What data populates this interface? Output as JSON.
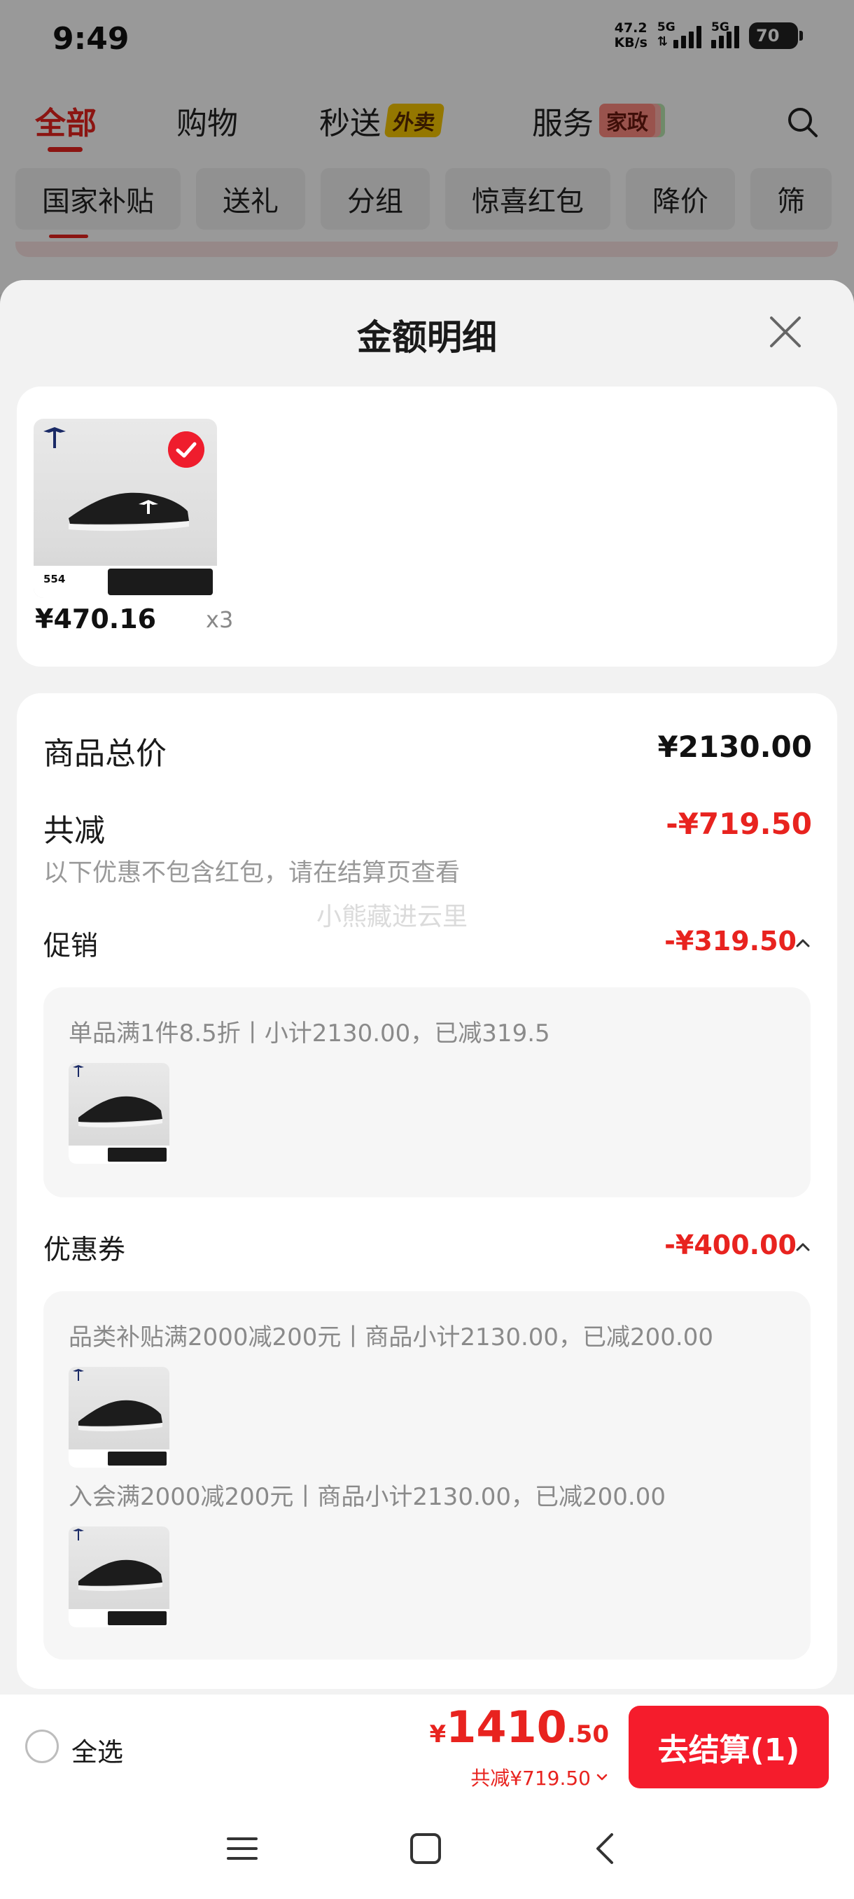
{
  "status_bar": {
    "time": "9:49",
    "net_speed_value": "47.2",
    "net_speed_unit": "KB/s",
    "sim1_label": "5G",
    "sim2_label": "5G",
    "battery": "70"
  },
  "top_tabs": [
    {
      "label": "全部"
    },
    {
      "label": "购物"
    },
    {
      "label": "秒送",
      "badge": "外卖"
    },
    {
      "label": "服务",
      "badge": "家政"
    }
  ],
  "chips": [
    "国家补贴",
    "送礼",
    "分组",
    "惊喜红包",
    "降价",
    "筛"
  ],
  "sheet": {
    "title": "金额明细",
    "product": {
      "price": "¥470.16",
      "qty": "x3",
      "thumb_price": "554"
    },
    "total_price_label": "商品总价",
    "total_price_value": "¥2130.00",
    "total_discount_label": "共减",
    "total_discount_value": "-¥719.50",
    "note": "以下优惠不包含红包，请在结算页查看",
    "watermark": "小熊藏进云里",
    "promo": {
      "label": "促销",
      "value": "-¥319.50",
      "items": [
        "单品满1件8.5折丨小计2130.00，已减319.5"
      ]
    },
    "coupon": {
      "label": "优惠券",
      "value": "-¥400.00",
      "items": [
        "品类补贴满2000减200元丨商品小计2130.00，已减200.00",
        "入会满2000减200元丨商品小计2130.00，已减200.00"
      ]
    }
  },
  "checkout": {
    "select_all": "全选",
    "currency": "¥",
    "total_int": "1410",
    "total_dec": ".50",
    "discount": "共减¥719.50",
    "button": "去结算(1)"
  },
  "colors": {
    "accent": "#e8231f",
    "button": "#f51c2c"
  }
}
